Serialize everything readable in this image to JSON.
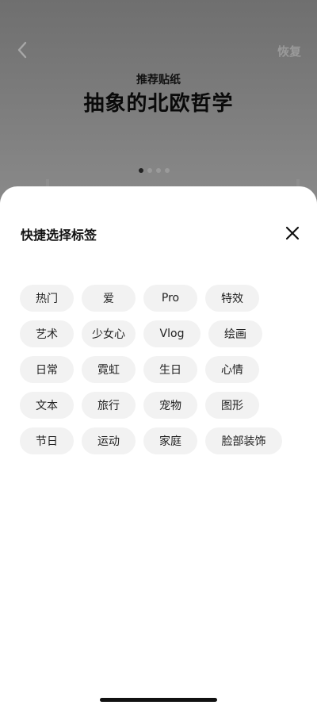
{
  "header": {
    "restore_label": "恢复",
    "subtitle": "推荐贴纸",
    "title": "抽象的北欧哲学",
    "page_count": 4,
    "active_page": 1
  },
  "sheet": {
    "title": "快捷选择标签",
    "tags": [
      "热门",
      "爱",
      "Pro",
      "特效",
      "艺术",
      "少女心",
      "Vlog",
      "绘画",
      "日常",
      "霓虹",
      "生日",
      "心情",
      "文本",
      "旅行",
      "宠物",
      "图形",
      "节日",
      "运动",
      "家庭",
      "脸部装饰"
    ]
  }
}
